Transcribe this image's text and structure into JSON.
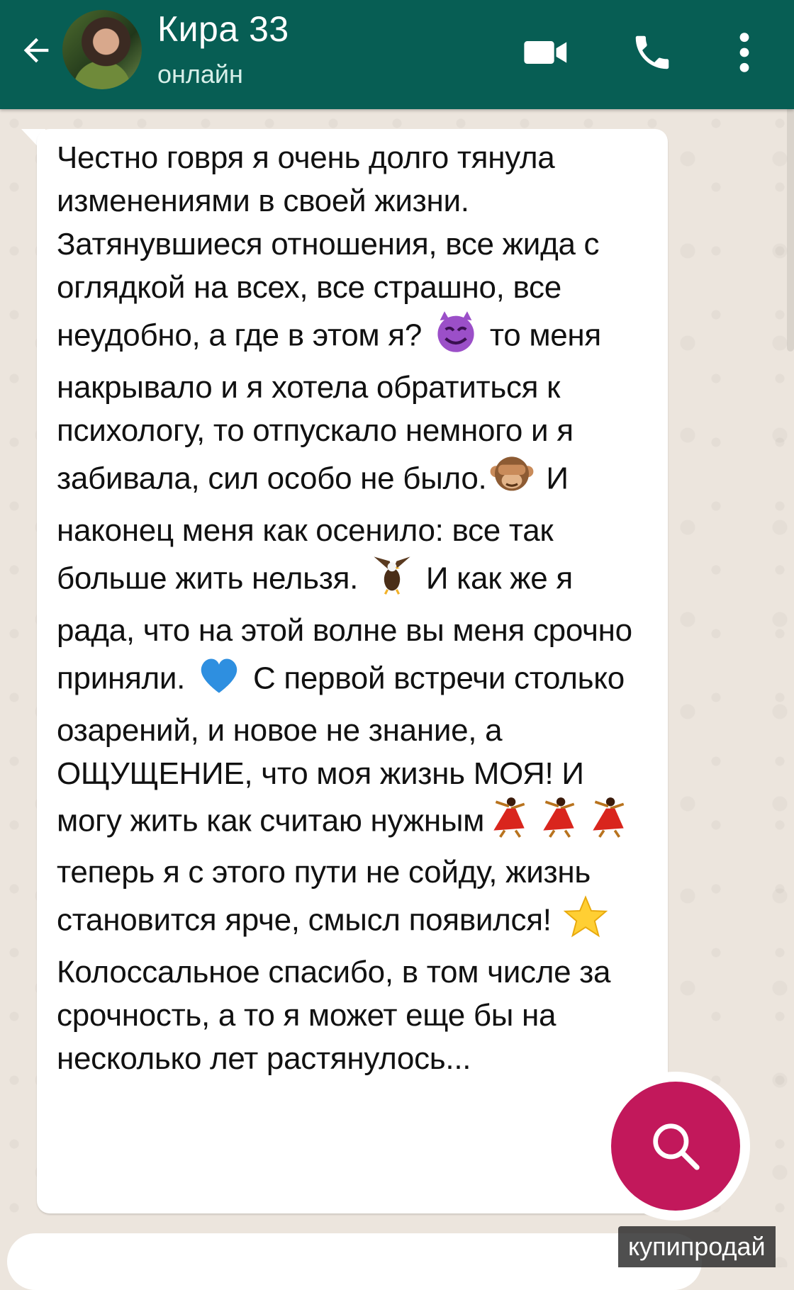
{
  "header": {
    "contact_name": "Кира 33",
    "status": "онлайн",
    "back_icon": "arrow-left-icon",
    "video_icon": "video-camera-icon",
    "call_icon": "phone-icon",
    "more_icon": "more-vertical-icon",
    "bg_color": "#075e54"
  },
  "message": {
    "parts": [
      "Честно говря я очень долго тянула  изменениями в своей жизни. Затянувшиеся отношения, все жида с оглядкой на всех, все страшно, все неудобно, а где в этом я? ",
      " то меня накрывало и я хотела обратиться к психологу, то отпускало немного и я забивала, сил особо не было.",
      " И наконец меня как осенило: все так больше жить нельзя. ",
      " И как же я рада, что на этой волне вы меня срочно приняли. ",
      " С первой встречи столько озарений, и новое не знание, а ОЩУЩЕНИЕ, что моя жизнь МОЯ! И могу жить как считаю нужным",
      " теперь я с этого пути не сойду, жизнь становится ярче, смысл появился! ",
      " Колоссальное спасибо, в том числе за срочность, а то я может еще бы на несколько лет растянулось..."
    ],
    "emojis": {
      "devil": "smiling-devil-emoji",
      "monkey": "see-no-evil-monkey-emoji",
      "eagle": "eagle-emoji",
      "heart": "blue-heart-emoji",
      "dancer": "dancer-emoji",
      "star": "star-emoji"
    }
  },
  "fab": {
    "icon": "search-icon",
    "color": "#c2185b"
  },
  "watermark": "купипродай"
}
